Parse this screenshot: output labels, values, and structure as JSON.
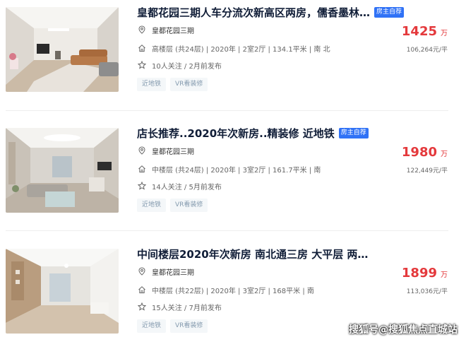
{
  "colors": {
    "title": "#101d37",
    "price": "#e4393c",
    "badge_bg": "#3072f6",
    "tag_text": "#849aae",
    "tag_bg": "#f4f7f9"
  },
  "icons": {
    "community": "location-pin-icon",
    "house_info": "house-icon",
    "follow_info": "star-icon"
  },
  "listings": [
    {
      "title": "皇都花园三期人车分流次新高区两房，儒香墨林…",
      "badge": "房主自荐",
      "community": "皇都花园三期",
      "house_info": "高楼层 (共24层) | 2020年 | 2室2厅 | 134.1平米 | 南 北",
      "follow_info": "10人关注 / 2月前发布",
      "tags": [
        "近地铁",
        "VR看装修"
      ],
      "total_price": "1425",
      "price_unit": "万",
      "unit_price": "106,264元/平"
    },
    {
      "title": "店长推荐..2020年次新房..精装修 近地铁",
      "badge": "房主自荐",
      "community": "皇都花园三期",
      "house_info": "中楼层 (共24层) | 2020年 | 3室2厅 | 161.7平米 | 南",
      "follow_info": "14人关注 / 5月前发布",
      "tags": [
        "近地铁",
        "VR看装修"
      ],
      "total_price": "1980",
      "price_unit": "万",
      "unit_price": "122,449元/平"
    },
    {
      "title": "中间楼层2020年次新房 南北通三房 大平层 两…",
      "community": "皇都花园三期",
      "house_info": "中楼层 (共22层) | 2020年 | 3室2厅 | 168平米 | 南",
      "follow_info": "15人关注 / 7月前发布",
      "tags": [
        "近地铁",
        "VR看装修"
      ],
      "total_price": "1899",
      "price_unit": "万",
      "unit_price": "113,036元/平"
    }
  ],
  "watermark": "搜狐号@搜狐焦点直城站"
}
